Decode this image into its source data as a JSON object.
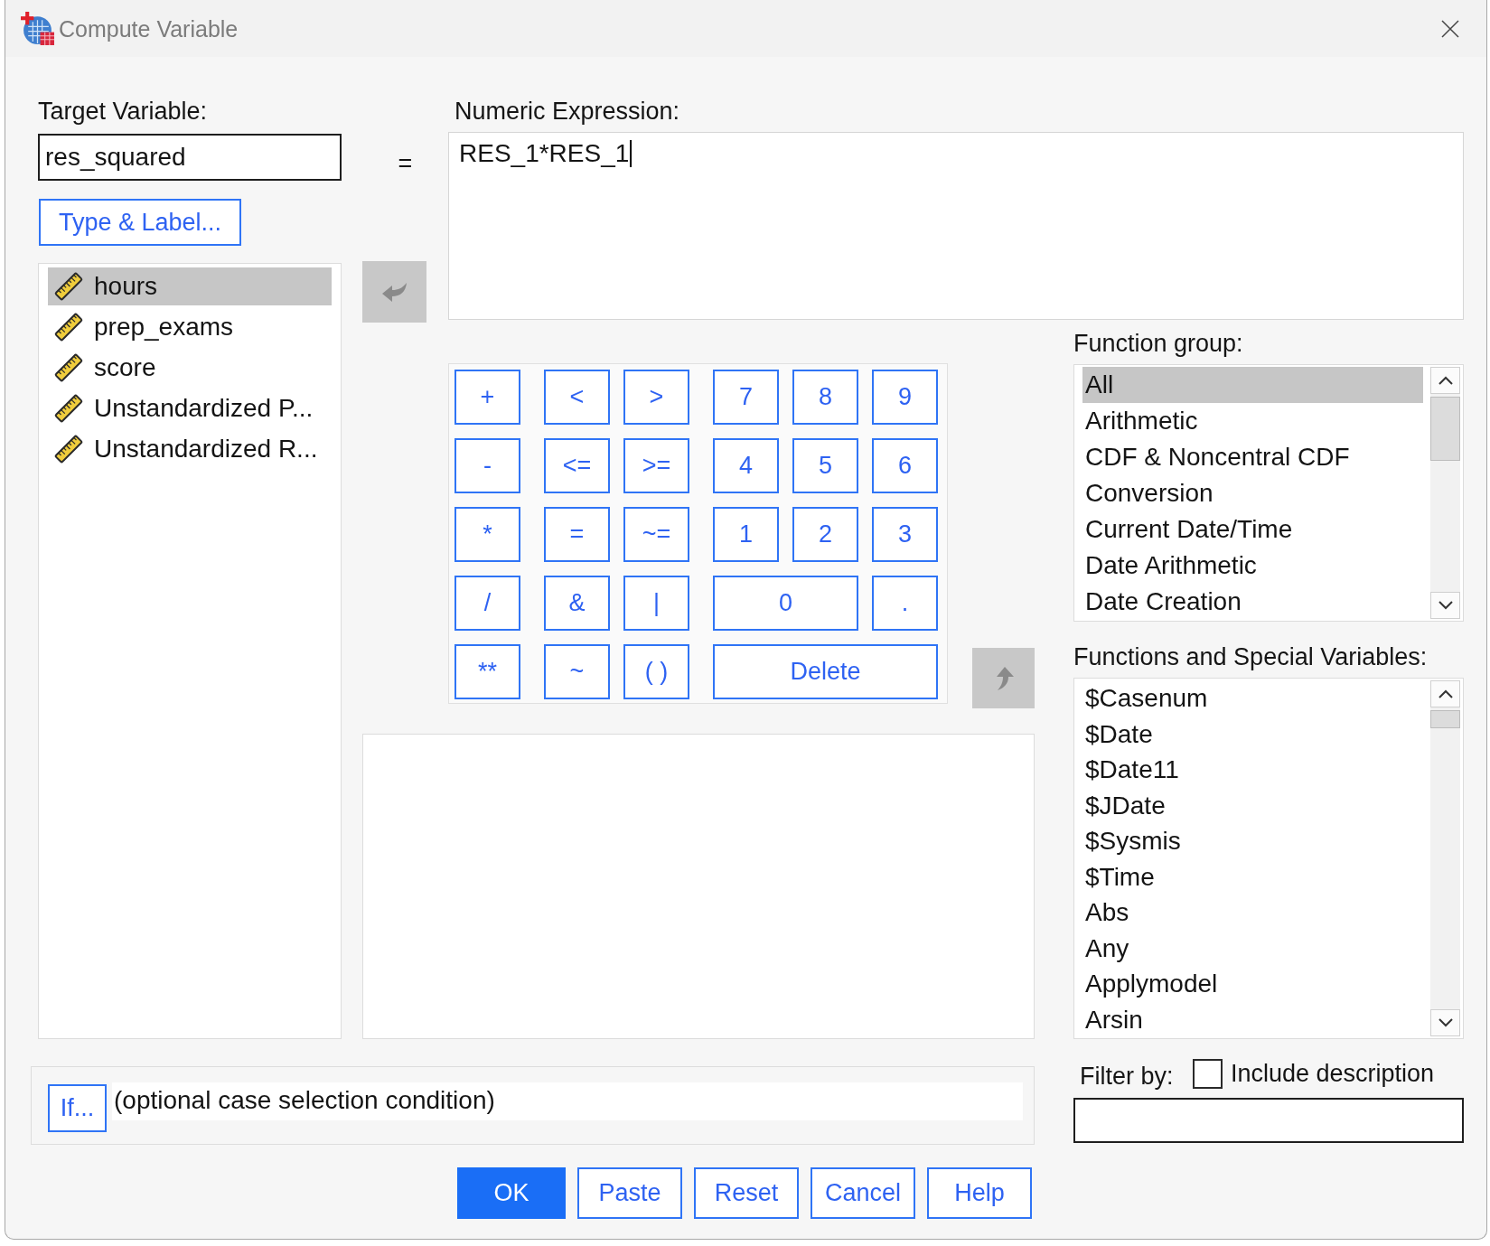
{
  "window": {
    "title": "Compute Variable"
  },
  "target_variable": {
    "label": "Target Variable:",
    "value": "res_squared"
  },
  "equals": "=",
  "numeric_expression": {
    "label": "Numeric Expression:",
    "value": "RES_1*RES_1",
    "focused": true
  },
  "type_label_button": {
    "label": "Type & Label..."
  },
  "variables": [
    {
      "name": "hours",
      "selected": true
    },
    {
      "name": "prep_exams",
      "selected": false
    },
    {
      "name": "score",
      "selected": false
    },
    {
      "name": "Unstandardized P...",
      "selected": false
    },
    {
      "name": "Unstandardized R...",
      "selected": false
    }
  ],
  "move_to_expression_button": {
    "disabled": true
  },
  "keypad": {
    "operators": [
      [
        "+",
        "<",
        ">"
      ],
      [
        "-",
        "<=",
        ">="
      ],
      [
        "*",
        "=",
        "~="
      ],
      [
        "/",
        "&",
        "|"
      ],
      [
        "**",
        "~",
        "( )"
      ]
    ],
    "numbers": [
      [
        "7",
        "8",
        "9"
      ],
      [
        "4",
        "5",
        "6"
      ],
      [
        "1",
        "2",
        "3"
      ],
      [
        "0",
        "."
      ],
      [
        "Delete"
      ]
    ]
  },
  "insert_function_button": {
    "disabled": true
  },
  "function_group": {
    "label": "Function group:",
    "items": [
      {
        "name": "All",
        "selected": true
      },
      {
        "name": "Arithmetic",
        "selected": false
      },
      {
        "name": "CDF & Noncentral CDF",
        "selected": false
      },
      {
        "name": "Conversion",
        "selected": false
      },
      {
        "name": "Current Date/Time",
        "selected": false
      },
      {
        "name": "Date Arithmetic",
        "selected": false
      },
      {
        "name": "Date Creation",
        "selected": false
      }
    ]
  },
  "functions": {
    "label": "Functions and Special Variables:",
    "items": [
      {
        "name": "$Casenum",
        "selected": false
      },
      {
        "name": "$Date",
        "selected": false
      },
      {
        "name": "$Date11",
        "selected": false
      },
      {
        "name": "$JDate",
        "selected": false
      },
      {
        "name": "$Sysmis",
        "selected": false
      },
      {
        "name": "$Time",
        "selected": false
      },
      {
        "name": "Abs",
        "selected": false
      },
      {
        "name": "Any",
        "selected": false
      },
      {
        "name": "Applymodel",
        "selected": false
      },
      {
        "name": "Arsin",
        "selected": false
      }
    ]
  },
  "filter": {
    "label": "Filter by:",
    "include_description": {
      "label": "Include description",
      "checked": false
    }
  },
  "if_condition": {
    "button": "If...",
    "text": "(optional case selection condition)"
  },
  "buttons": [
    {
      "label": "OK",
      "default": true
    },
    {
      "label": "Paste",
      "default": false
    },
    {
      "label": "Reset",
      "default": false
    },
    {
      "label": "Cancel",
      "default": false
    },
    {
      "label": "Help",
      "default": false
    }
  ]
}
